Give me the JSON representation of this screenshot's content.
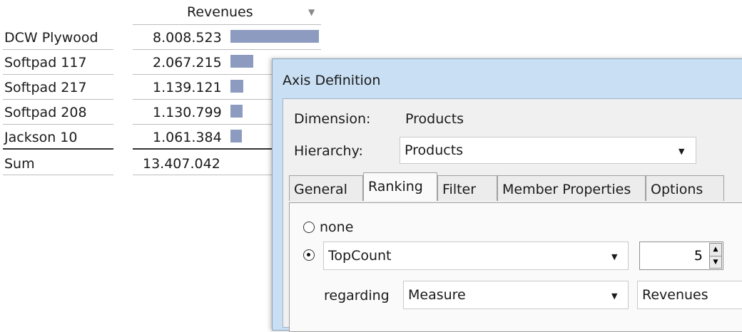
{
  "report": {
    "column_header": "Revenues",
    "filter_icon": "filter-icon",
    "rows": [
      {
        "label": "DCW Plywood",
        "value": "8.008.523",
        "bar_fraction": 1.0
      },
      {
        "label": "Softpad 117",
        "value": "2.067.215",
        "bar_fraction": 0.258
      },
      {
        "label": "Softpad 217",
        "value": "1.139.121",
        "bar_fraction": 0.142
      },
      {
        "label": "Softpad 208",
        "value": "1.130.799",
        "bar_fraction": 0.141
      },
      {
        "label": "Jackson 10",
        "value": "1.061.384",
        "bar_fraction": 0.133
      }
    ],
    "sum_label": "Sum",
    "sum_value": "13.407.042",
    "bar_color": "#8c9bbf"
  },
  "dialog": {
    "title": "Axis Definition",
    "dimension_label": "Dimension:",
    "dimension_value": "Products",
    "hierarchy_label": "Hierarchy:",
    "hierarchy_value": "Products",
    "tabs": [
      {
        "label": "General",
        "active": false
      },
      {
        "label": "Ranking",
        "active": true
      },
      {
        "label": "Filter",
        "active": false
      },
      {
        "label": "Member Properties",
        "active": false
      },
      {
        "label": "Options",
        "active": false
      }
    ],
    "ranking": {
      "none_label": "none",
      "topcount_value": "TopCount",
      "count_value": "5",
      "regarding_label": "regarding",
      "regarding_value": "Measure",
      "measure_value": "Revenues"
    }
  }
}
